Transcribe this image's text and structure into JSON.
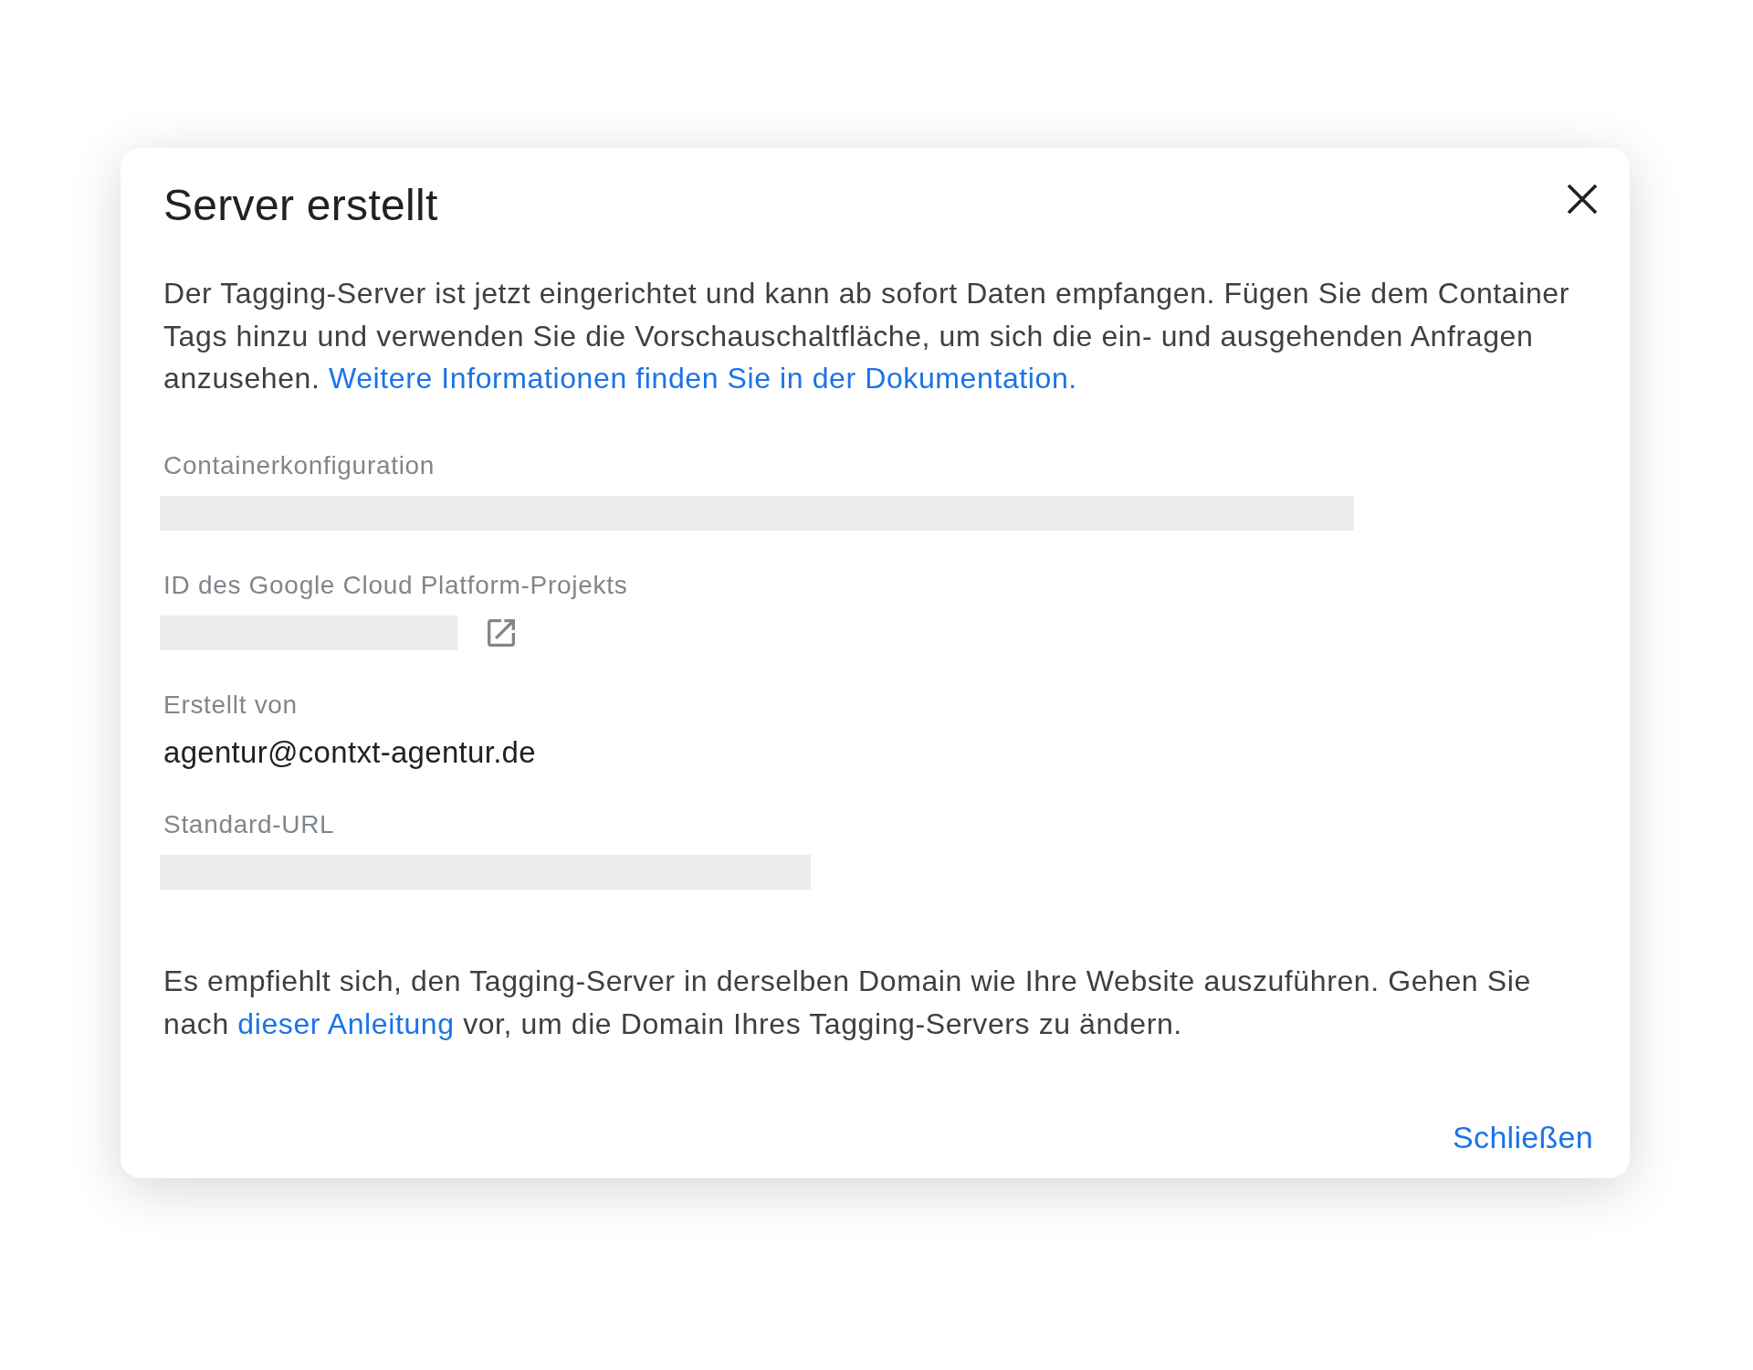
{
  "dialog": {
    "title": "Server erstellt",
    "intro": {
      "text": "Der Tagging-Server ist jetzt eingerichtet und kann ab sofort Daten empfangen. Fügen Sie dem Container Tags hinzu und verwenden Sie die Vorschauschaltfläche, um sich die ein- und ausgehenden Anfragen anzusehen.",
      "link": "Weitere Informationen finden Sie in der Dokumentation."
    },
    "fields": [
      {
        "label": "Containerkonfiguration",
        "kind": "redacted"
      },
      {
        "label": "ID des Google Cloud Platform-Projekts",
        "kind": "redacted_link"
      },
      {
        "label": "Erstellt von",
        "kind": "text",
        "value": "agentur@contxt-agentur.de"
      },
      {
        "label": "Standard-URL",
        "kind": "redacted"
      }
    ],
    "note": {
      "before": "Es empfiehlt sich, den Tagging-Server in derselben Domain wie Ihre Website auszuführen. Gehen Sie nach",
      "link": "dieser Anleitung",
      "after": "vor, um die Domain Ihres Tagging-Servers zu ändern."
    },
    "actions": [
      {
        "label": "Schließen"
      }
    ]
  }
}
